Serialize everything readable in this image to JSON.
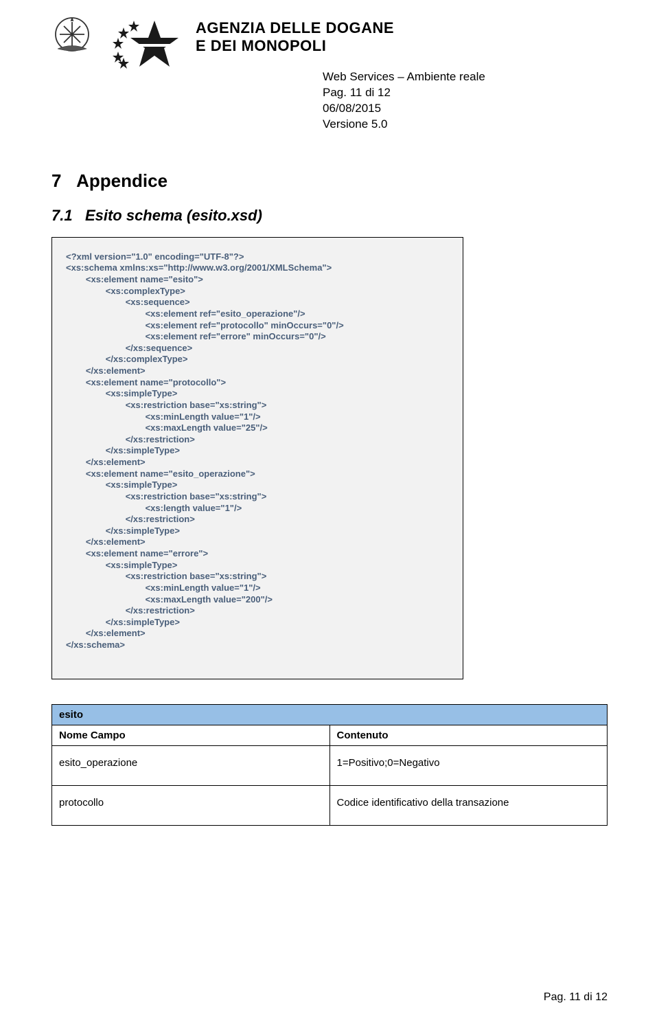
{
  "header": {
    "agency_line1": "AGENZIA DELLE DOGANE",
    "agency_line2": "E DEI MONOPOLI",
    "meta": {
      "title": "Web Services – Ambiente reale",
      "page": "Pag. 11 di 12",
      "date": "06/08/2015",
      "version": "Versione 5.0"
    }
  },
  "sections": {
    "h1_num": "7",
    "h1_text": "Appendice",
    "h2_num": "7.1",
    "h2_text": "Esito schema  (esito.xsd)"
  },
  "code": "<?xml version=\"1.0\" encoding=\"UTF-8\"?>\n<xs:schema xmlns:xs=\"http://www.w3.org/2001/XMLSchema\">\n\t<xs:element name=\"esito\">\n\t\t<xs:complexType>\n\t\t\t<xs:sequence>\n\t\t\t\t<xs:element ref=\"esito_operazione\"/>\n\t\t\t\t<xs:element ref=\"protocollo\" minOccurs=\"0\"/>\n\t\t\t\t<xs:element ref=\"errore\" minOccurs=\"0\"/>\n\t\t\t</xs:sequence>\n\t\t</xs:complexType>\n\t</xs:element>\n\t<xs:element name=\"protocollo\">\n\t\t<xs:simpleType>\n\t\t\t<xs:restriction base=\"xs:string\">\n\t\t\t\t<xs:minLength value=\"1\"/>\n\t\t\t\t<xs:maxLength value=\"25\"/>\n\t\t\t</xs:restriction>\n\t\t</xs:simpleType>\n\t</xs:element>\n\t<xs:element name=\"esito_operazione\">\n\t\t<xs:simpleType>\n\t\t\t<xs:restriction base=\"xs:string\">\n\t\t\t\t<xs:length value=\"1\"/>\n\t\t\t</xs:restriction>\n\t\t</xs:simpleType>\n\t</xs:element>\n\t<xs:element name=\"errore\">\n\t\t<xs:simpleType>\n\t\t\t<xs:restriction base=\"xs:string\">\n\t\t\t\t<xs:minLength value=\"1\"/>\n\t\t\t\t<xs:maxLength value=\"200\"/>\n\t\t\t</xs:restriction>\n\t\t</xs:simpleType>\n\t</xs:element>\n</xs:schema>",
  "table": {
    "title": "esito",
    "head_left": "Nome Campo",
    "head_right": "Contenuto",
    "rows": [
      {
        "left": "esito_operazione",
        "right": "1=Positivo;0=Negativo"
      },
      {
        "left": "protocollo",
        "right": "Codice identificativo della transazione"
      }
    ]
  },
  "footer": {
    "page": "Pag. 11 di 12"
  }
}
